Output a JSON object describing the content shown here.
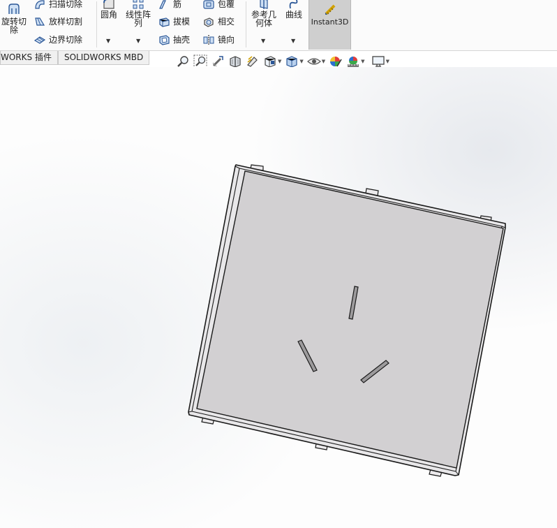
{
  "ribbon": {
    "revolve_cut": "旋转切除",
    "sweep_cut": "扫描切除",
    "loft_cut": "放样切割",
    "boundary_cut": "边界切除",
    "fillet": "圆角",
    "linear_pattern": "线性阵列",
    "rib": "筋",
    "draft": "拔模",
    "shell": "抽壳",
    "wrap": "包覆",
    "intersect": "相交",
    "mirror": "镜向",
    "ref_geometry": "参考几何体",
    "curves": "曲线",
    "instant3d": "Instant3D"
  },
  "tabs": [
    "WORKS 插件",
    "SOLIDWORKS MBD"
  ],
  "icons": {
    "zoom_fit": "zoom-to-fit-icon",
    "zoom_area": "zoom-area-icon",
    "previous_view": "previous-view-icon",
    "section_view": "section-view-icon",
    "dynamic_annotation": "dynamic-annotation-icon",
    "view_orientation": "view-orientation-icon",
    "display_style": "display-style-icon",
    "hide_show": "hide-show-icon",
    "edit_appearance": "edit-appearance-icon",
    "apply_scene": "apply-scene-icon",
    "view_settings": "view-settings-icon"
  },
  "colors": {
    "part_face": "#d2d0d2",
    "part_edge": "#1a1a1a",
    "instant3d_active": "#cfcfcf"
  }
}
